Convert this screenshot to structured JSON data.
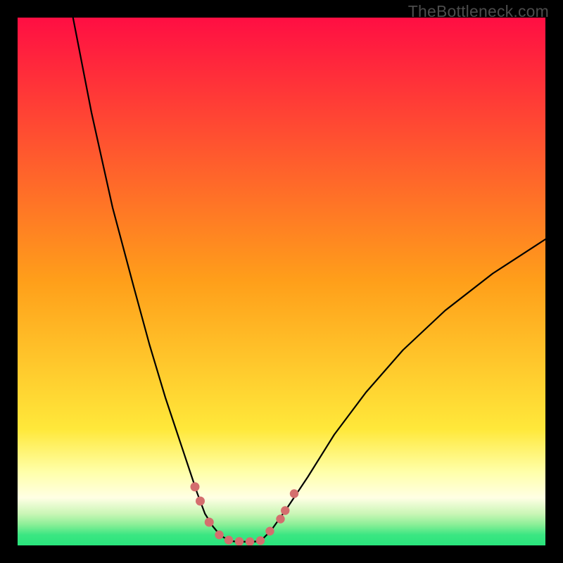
{
  "watermark": "TheBottleneck.com",
  "colors": {
    "bg_top": "#ff0e43",
    "bg_mid": "#ffd400",
    "bg_pale": "#ffffa8",
    "bg_green": "#29e47c",
    "curve": "#000000",
    "marker_fill": "#d46e6e",
    "marker_stroke": "#a44b4b"
  },
  "chart_data": {
    "type": "line",
    "title": "",
    "xlabel": "",
    "ylabel": "",
    "xlim": [
      0,
      100
    ],
    "ylim": [
      0,
      100
    ],
    "curve_left": {
      "x": [
        10.5,
        14,
        18,
        22,
        25,
        28,
        30,
        32,
        34,
        35.5,
        37,
        38.5,
        40.5
      ],
      "y": [
        100,
        82,
        64,
        49,
        38,
        28,
        22,
        16,
        10,
        6,
        3.6,
        1.8,
        0.8
      ]
    },
    "plateau": {
      "x": [
        40.5,
        41.8,
        43.2,
        44.6,
        46.0
      ],
      "y": [
        0.8,
        0.7,
        0.7,
        0.7,
        0.8
      ]
    },
    "curve_right": {
      "x": [
        46.0,
        48,
        51,
        55,
        60,
        66,
        73,
        81,
        90,
        100
      ],
      "y": [
        0.8,
        2.8,
        7,
        13,
        21,
        29,
        37,
        44.5,
        51.5,
        58
      ]
    },
    "markers": [
      {
        "x": 33.6,
        "y": 11.1,
        "r": 6.5
      },
      {
        "x": 34.6,
        "y": 8.4,
        "r": 6.5
      },
      {
        "x": 36.3,
        "y": 4.4,
        "r": 6.5
      },
      {
        "x": 38.2,
        "y": 2.0,
        "r": 6.2
      },
      {
        "x": 40.0,
        "y": 1.0,
        "r": 6.2
      },
      {
        "x": 42.0,
        "y": 0.75,
        "r": 6.2
      },
      {
        "x": 44.0,
        "y": 0.72,
        "r": 6.2
      },
      {
        "x": 46.0,
        "y": 0.9,
        "r": 6.2
      },
      {
        "x": 47.8,
        "y": 2.7,
        "r": 6.2
      },
      {
        "x": 49.8,
        "y": 5.0,
        "r": 6.2
      },
      {
        "x": 50.7,
        "y": 6.6,
        "r": 6.2
      },
      {
        "x": 52.4,
        "y": 9.8,
        "r": 6.2
      }
    ]
  }
}
